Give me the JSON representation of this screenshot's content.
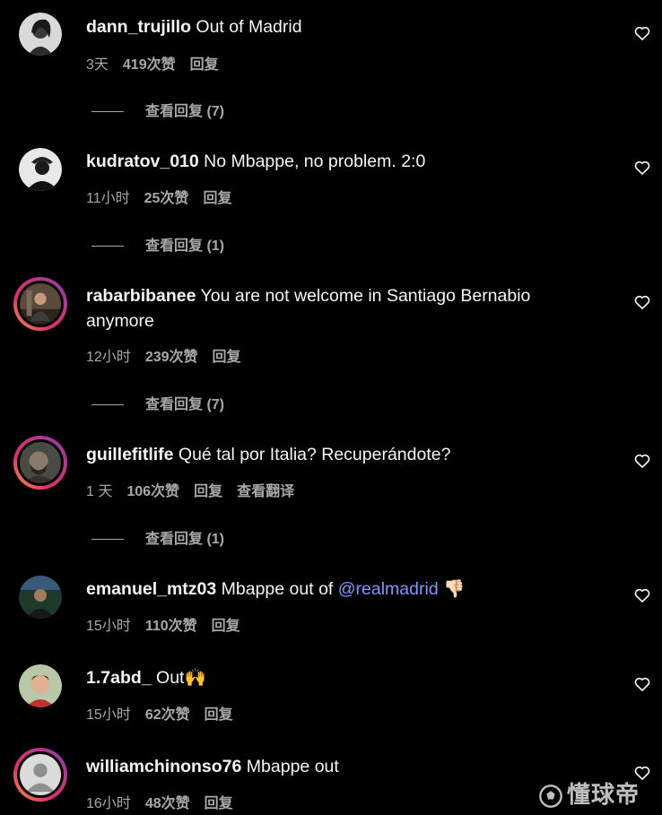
{
  "comments": [
    {
      "username": "dann_trujillo",
      "text": " Out of Madrid",
      "time": "3天",
      "likes": "419次赞",
      "reply": "回复",
      "view_replies": "查看回复 (7)",
      "avatar": "portrait-woman"
    },
    {
      "username": "kudratov_010",
      "text": " No Mbappe, no problem. 2:0",
      "time": "11小时",
      "likes": "25次赞",
      "reply": "回复",
      "view_replies": "查看回复 (1)",
      "avatar": "portrait-man-dark"
    },
    {
      "username": "rabarbibanee",
      "text": " You are not welcome in Santiago Bernabio anymore",
      "time": "12小时",
      "likes": "239次赞",
      "reply": "回复",
      "view_replies": "查看回复 (7)",
      "avatar": "gym-photo"
    },
    {
      "username": "guillefitlife",
      "text": " Qué tal por Italia? Recuperándote?",
      "time": "1 天",
      "likes": "106次赞",
      "reply": "回复",
      "translate": "查看翻译",
      "view_replies": "查看回复 (1)",
      "avatar": "bearded-man"
    },
    {
      "username": "emanuel_mtz03",
      "text_pre": " Mbappe out of ",
      "mention": "@realmadrid",
      "text_post": " 👎🏻",
      "time": "15小时",
      "likes": "110次赞",
      "reply": "回复",
      "avatar": "stadium-man"
    },
    {
      "username": "1.7abd_",
      "text": " Out🙌",
      "time": "15小时",
      "likes": "62次赞",
      "reply": "回复",
      "avatar": "child-photo"
    },
    {
      "username": "williamchinonso76",
      "text": " Mbappe out",
      "time": "16小时",
      "likes": "48次赞",
      "reply": "回复",
      "avatar": "default-avatar"
    }
  ],
  "watermark": "懂球帝",
  "colors": {
    "background": "#000000",
    "text": "#f5f5f5",
    "secondary": "#a8a8a8",
    "mention": "#7f96ff",
    "story_ring": [
      "#f9a030",
      "#e1306c",
      "#833ab4"
    ]
  }
}
